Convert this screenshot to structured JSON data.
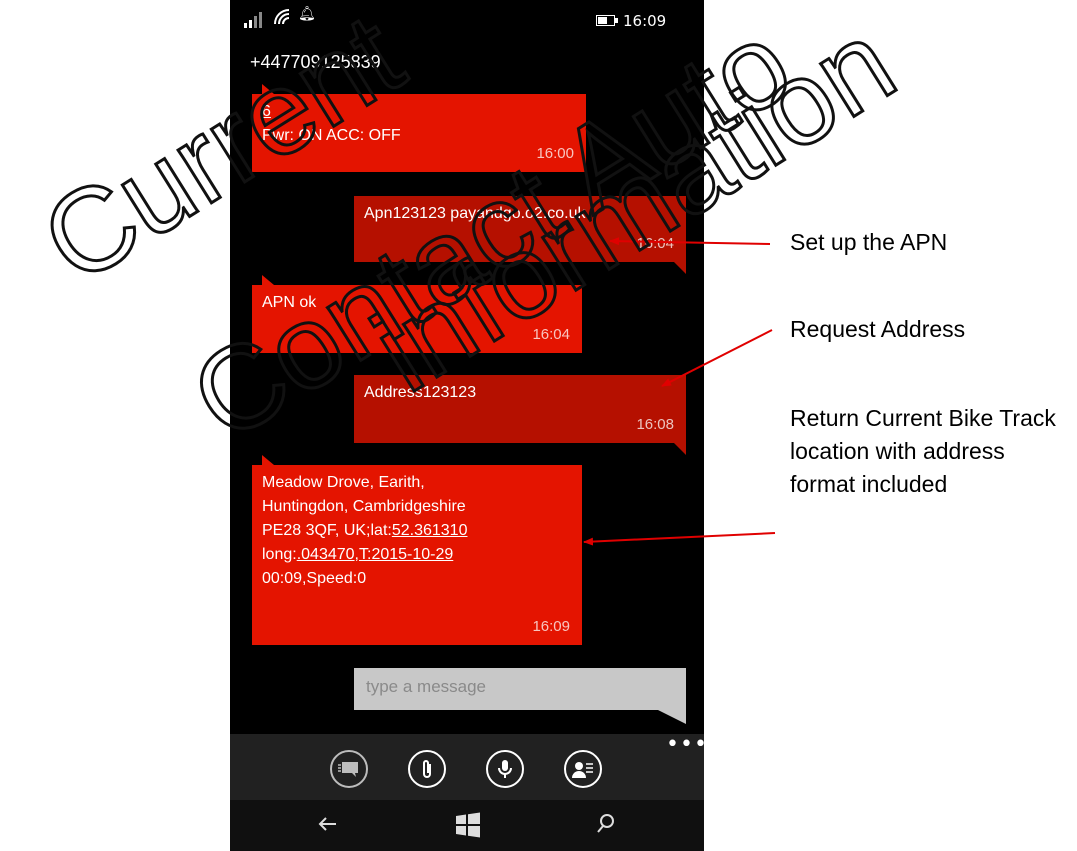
{
  "status_bar": {
    "time": "16:09"
  },
  "conversation": {
    "contact_number": "+447709125839",
    "messages": [
      {
        "line1": "6",
        "line2": "Pwr: ON ACC: OFF",
        "time": "16:00"
      },
      {
        "text": "Apn123123 payandgo.o2.co.uk",
        "time": "16:04"
      },
      {
        "text": "APN ok",
        "time": "16:04"
      },
      {
        "text": "Address123123",
        "time": "16:08"
      },
      {
        "line1": "Meadow Drove, Earith,",
        "line2": "Huntingdon, Cambridgeshire",
        "line3_prefix": "PE28 3QF, UK;lat:",
        "lat": "52.361310",
        "line4_prefix": "long:",
        "long": ".043470",
        "line4_suffix": ",T:2015-10-29",
        "line5": "00:09,Speed:0",
        "time": "16:09"
      }
    ]
  },
  "compose": {
    "placeholder": "type a message"
  },
  "app_bar": {
    "more_label": "•••"
  },
  "annotations": {
    "apn": "Set up the APN",
    "request": "Request Address",
    "return": "Return Current Bike Track location with address format included"
  },
  "colors": {
    "incoming": "#e41400",
    "outgoing": "#b51000",
    "arrow": "#e00000"
  }
}
